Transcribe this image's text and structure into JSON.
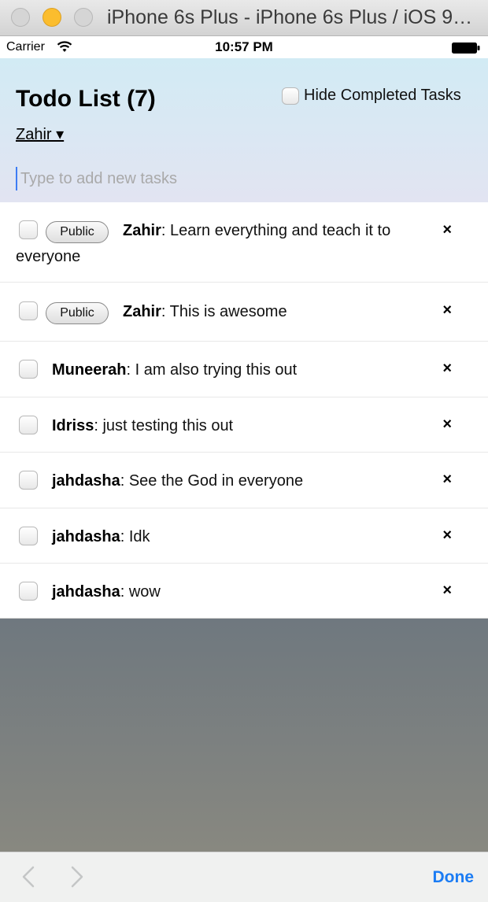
{
  "window": {
    "title": "iPhone 6s Plus - iPhone 6s Plus / iOS 9.0 (13A340)"
  },
  "status_bar": {
    "carrier": "Carrier",
    "time": "10:57 PM"
  },
  "header": {
    "title": "Todo List (7)",
    "hide_completed_label": "Hide Completed Tasks",
    "hide_completed_checked": false,
    "user_select_label": "Zahir ▾",
    "new_task_placeholder": "Type to add new tasks",
    "new_task_value": ""
  },
  "tasks": [
    {
      "user": "Zahir",
      "text": ": Learn everything and teach it to everyone",
      "public_label": "Public",
      "checked": false,
      "delete_label": "×"
    },
    {
      "user": "Zahir",
      "text": ": This is awesome",
      "public_label": "Public",
      "checked": false,
      "delete_label": "×"
    },
    {
      "user": "Muneerah",
      "text": ": I am also trying this out",
      "checked": false,
      "delete_label": "×"
    },
    {
      "user": "Idriss",
      "text": ": just testing this out",
      "checked": false,
      "delete_label": "×"
    },
    {
      "user": "jahdasha",
      "text": ": See the God in everyone",
      "checked": false,
      "delete_label": "×"
    },
    {
      "user": "jahdasha",
      "text": ": Idk",
      "checked": false,
      "delete_label": "×"
    },
    {
      "user": "jahdasha",
      "text": ": wow",
      "checked": false,
      "delete_label": "×"
    }
  ],
  "toolbar": {
    "back_icon": "chevron-left-icon",
    "forward_icon": "chevron-right-icon",
    "done_label": "Done"
  },
  "colors": {
    "header_gradient_top": "#d2ebf4",
    "header_gradient_bottom": "#e2e4f2",
    "accent_blue": "#1b7cf4",
    "traffic_yellow": "#fbbd2e"
  }
}
